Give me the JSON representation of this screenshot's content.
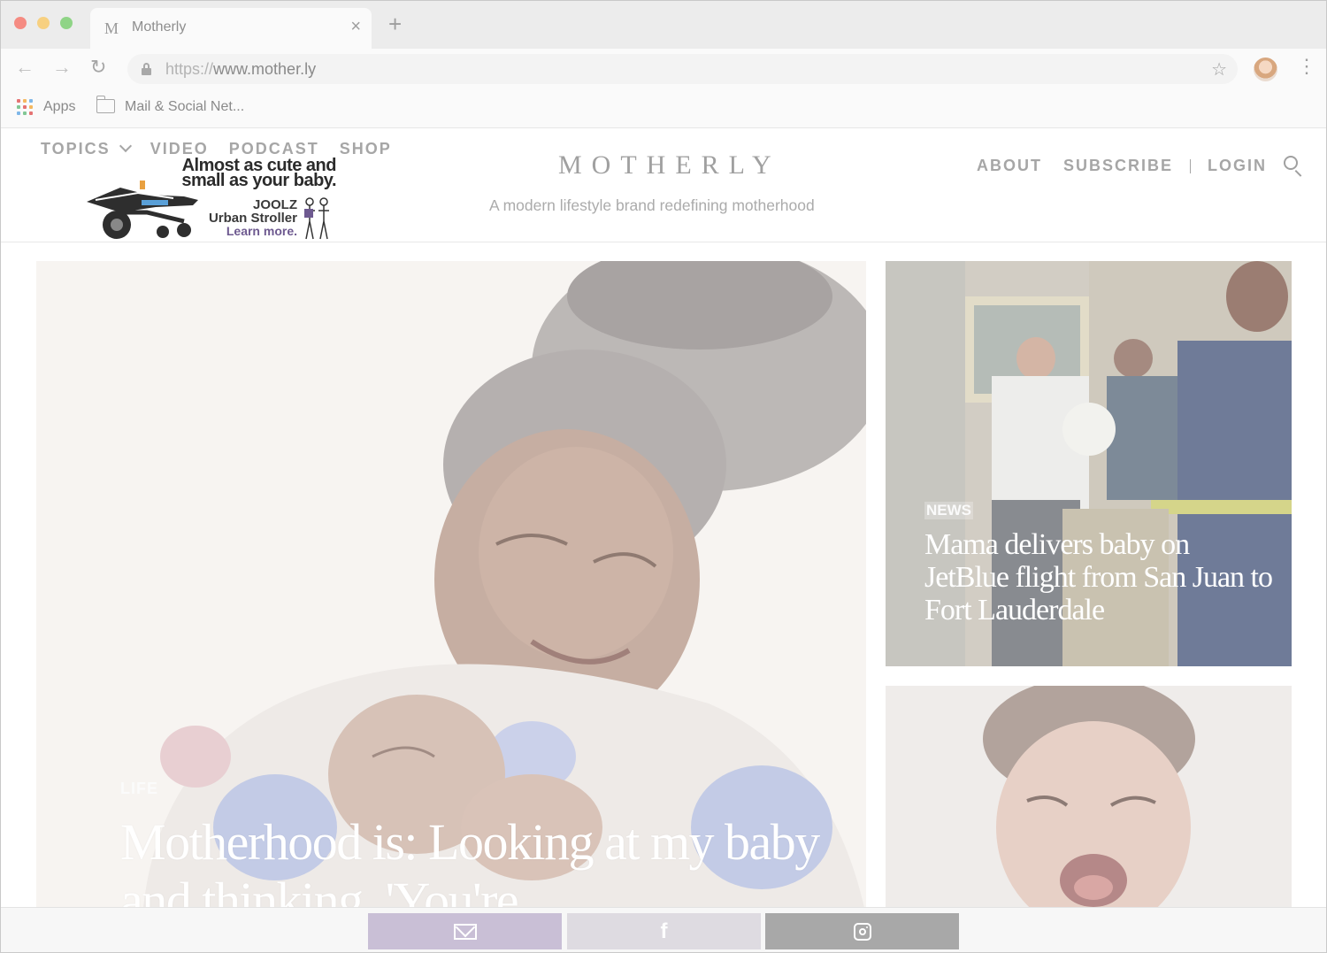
{
  "browser": {
    "tab_title": "Motherly",
    "tab_favicon": "M",
    "new_tab_symbol": "+",
    "close_symbol": "×",
    "url_scheme": "https://",
    "url_host": "www.mother.ly",
    "bookmarks": [
      {
        "label": "Apps",
        "icon": "apps-grid-icon"
      },
      {
        "label": "Mail & Social Net...",
        "icon": "folder-icon"
      }
    ]
  },
  "site": {
    "brand": "MOTHERLY",
    "tagline": "A modern lifestyle brand redefining motherhood",
    "left_nav": [
      "TOPICS",
      "VIDEO",
      "PODCAST",
      "SHOP"
    ],
    "right_nav": [
      "ABOUT",
      "SUBSCRIBE",
      "LOGIN"
    ]
  },
  "ad": {
    "headline": "Almost as cute and small as your baby.",
    "brand": "JOOLZ",
    "product": "Urban Stroller",
    "cta": "Learn more."
  },
  "hero": {
    "tag": "LIFE",
    "title": "Motherhood is: Looking at my baby and thinking, 'You're..."
  },
  "card1": {
    "tag": "NEWS",
    "title": "Mama delivers baby on JetBlue flight from San Juan to Fort Lauderdale"
  },
  "share": {
    "buttons": [
      "email-icon",
      "facebook-icon",
      "instagram-icon"
    ],
    "colors": {
      "email": "#c9bfd6",
      "facebook": "#dedbe1",
      "instagram": "#a8a8a8"
    }
  },
  "colors": {
    "traffic_red": "#f58b82",
    "traffic_yellow": "#f7d080",
    "traffic_green": "#8fd486",
    "nav_text": "#a6a6a6"
  }
}
